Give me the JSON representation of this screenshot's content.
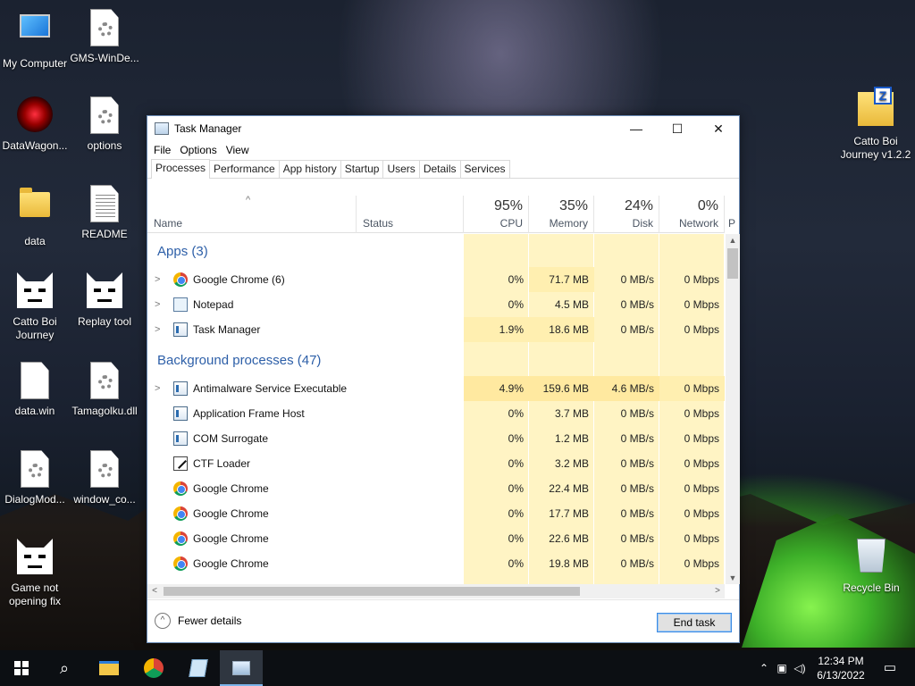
{
  "desktop": {
    "icons": [
      {
        "label": "My Computer"
      },
      {
        "label": "GMS-WinDe..."
      },
      {
        "label": "DataWagon..."
      },
      {
        "label": "options"
      },
      {
        "label": "data"
      },
      {
        "label": "README"
      },
      {
        "label": "Catto Boi Journey"
      },
      {
        "label": "Replay tool"
      },
      {
        "label": "data.win"
      },
      {
        "label": "Tamagolku.dll"
      },
      {
        "label": "DialogMod..."
      },
      {
        "label": "window_co..."
      },
      {
        "label": "Game not opening fix"
      },
      {
        "label": "Catto Boi Journey v1.2.2"
      },
      {
        "label": "Recycle Bin"
      }
    ]
  },
  "window": {
    "title": "Task Manager",
    "controls": {
      "minimize": "—",
      "maximize": "☐",
      "close": "✕"
    },
    "menu": [
      "File",
      "Options",
      "View"
    ],
    "tabs": [
      "Processes",
      "Performance",
      "App history",
      "Startup",
      "Users",
      "Details",
      "Services"
    ],
    "active_tab": "Processes",
    "columns": {
      "name": "Name",
      "status": "Status",
      "cpu": {
        "pct": "95%",
        "label": "CPU"
      },
      "memory": {
        "pct": "35%",
        "label": "Memory"
      },
      "disk": {
        "pct": "24%",
        "label": "Disk"
      },
      "network": {
        "pct": "0%",
        "label": "Network"
      },
      "power": "P"
    },
    "groups": {
      "apps": "Apps (3)",
      "background": "Background processes (47)"
    },
    "apps": [
      {
        "name": "Google Chrome (6)",
        "icon": "chrome-icon",
        "cpu": "0%",
        "memory": "71.7 MB",
        "disk": "0 MB/s",
        "network": "0 Mbps"
      },
      {
        "name": "Notepad",
        "icon": "notepad-icon",
        "cpu": "0%",
        "memory": "4.5 MB",
        "disk": "0 MB/s",
        "network": "0 Mbps"
      },
      {
        "name": "Task Manager",
        "icon": "task-manager-icon",
        "cpu": "1.9%",
        "memory": "18.6 MB",
        "disk": "0 MB/s",
        "network": "0 Mbps"
      }
    ],
    "background": [
      {
        "name": "Antimalware Service Executable",
        "icon": "service-icon",
        "cpu": "4.9%",
        "memory": "159.6 MB",
        "disk": "4.6 MB/s",
        "network": "0 Mbps"
      },
      {
        "name": "Application Frame Host",
        "icon": "app-icon",
        "cpu": "0%",
        "memory": "3.7 MB",
        "disk": "0 MB/s",
        "network": "0 Mbps"
      },
      {
        "name": "COM Surrogate",
        "icon": "app-icon",
        "cpu": "0%",
        "memory": "1.2 MB",
        "disk": "0 MB/s",
        "network": "0 Mbps"
      },
      {
        "name": "CTF Loader",
        "icon": "ctf-icon",
        "cpu": "0%",
        "memory": "3.2 MB",
        "disk": "0 MB/s",
        "network": "0 Mbps"
      },
      {
        "name": "Google Chrome",
        "icon": "chrome-icon",
        "cpu": "0%",
        "memory": "22.4 MB",
        "disk": "0 MB/s",
        "network": "0 Mbps"
      },
      {
        "name": "Google Chrome",
        "icon": "chrome-icon",
        "cpu": "0%",
        "memory": "17.7 MB",
        "disk": "0 MB/s",
        "network": "0 Mbps"
      },
      {
        "name": "Google Chrome",
        "icon": "chrome-icon",
        "cpu": "0%",
        "memory": "22.6 MB",
        "disk": "0 MB/s",
        "network": "0 Mbps"
      },
      {
        "name": "Google Chrome",
        "icon": "chrome-icon",
        "cpu": "0%",
        "memory": "19.8 MB",
        "disk": "0 MB/s",
        "network": "0 Mbps"
      }
    ],
    "footer": {
      "fewer_details": "Fewer details",
      "end_task": "End task"
    }
  },
  "taskbar": {
    "time": "12:34 PM",
    "date": "6/13/2022"
  }
}
